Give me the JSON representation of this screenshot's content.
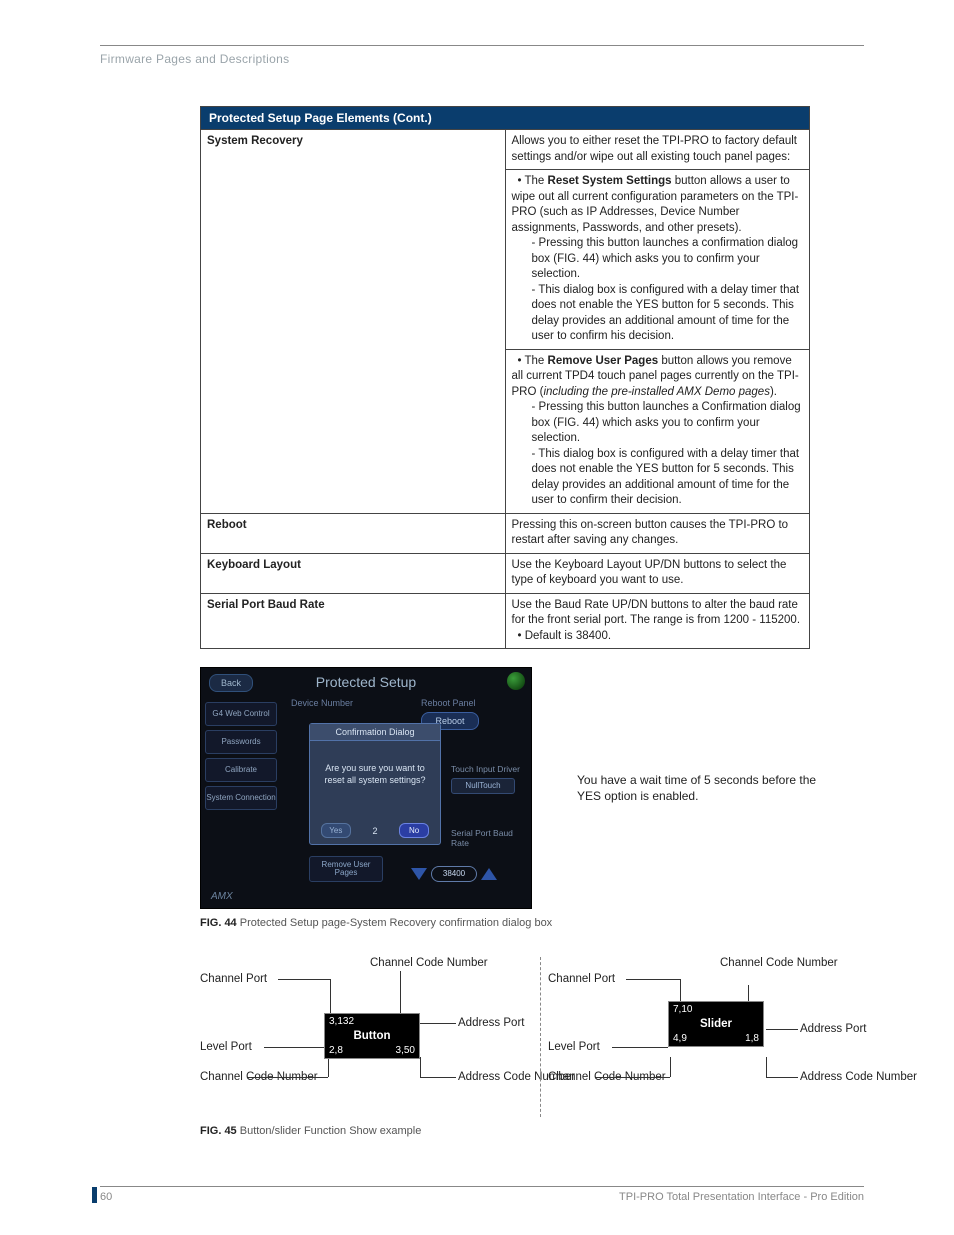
{
  "breadcrumb": "Firmware Pages and Descriptions",
  "table": {
    "title": "Protected Setup Page Elements (Cont.)",
    "rows": {
      "sysrec": {
        "label": "System Recovery",
        "intro": "Allows you to either reset the TPI-PRO to factory default settings and/or wipe out all existing touch panel pages:",
        "b1_lead": "Reset System Settings",
        "b1_tail": " button allows a user to wipe out all current configuration parameters on the TPI-PRO (such as IP Addresses, Device Number assignments, Passwords, and other presets).",
        "b1_s1": "- Pressing this button launches a confirmation dialog box (FIG. 44) which asks you to confirm your selection.",
        "b1_s2": "- This dialog box is configured with a delay timer that does not enable the YES button for 5 seconds. This delay provides an additional amount of time for the user to confirm his decision.",
        "b2_lead": "Remove User Pages",
        "b2_tail": " button allows you remove all current TPD4 touch panel pages currently on the TPI-PRO (",
        "b2_em": "including the pre-installed AMX Demo pages",
        "b2_close": ").",
        "b2_s1": "- Pressing this button launches a Confirmation dialog box (FIG. 44) which asks you to confirm your selection.",
        "b2_s2": "- This dialog box is configured with a delay timer that does not enable the YES button for 5 seconds. This delay provides an additional amount of time for the user to confirm their decision."
      },
      "reboot": {
        "label": "Reboot",
        "text": "Pressing this on-screen button causes the TPI-PRO to restart after saving any changes."
      },
      "kbd": {
        "label": "Keyboard Layout",
        "text": "Use the Keyboard Layout UP/DN buttons to select the type of keyboard you want to use."
      },
      "baud": {
        "label": "Serial Port Baud Rate",
        "l1": "Use the Baud Rate UP/DN buttons to alter the baud rate for the front serial port. The range is from 1200 - 115200.",
        "l2": "Default is 38400."
      }
    }
  },
  "fig44": {
    "title": "Protected Setup",
    "back": "Back",
    "side1": "G4 Web Control",
    "side2": "Passwords",
    "side3": "Calibrate",
    "side4": "System Connection",
    "devnum": "Device Number",
    "reboot_lbl": "Reboot Panel",
    "reboot_btn": "Reboot",
    "dlg_title": "Confirmation Dialog",
    "dlg_msg": "Are you sure you want to reset all system settings?",
    "dlg_yes": "Yes",
    "dlg_cnt": "2",
    "dlg_no": "No",
    "touch_lbl": "Touch Input Driver",
    "nulltouch": "NullTouch",
    "baud_lbl": "Serial Port Baud Rate",
    "remove": "Remove User Pages",
    "baud_val": "38400",
    "logo": "AMX",
    "note": "You have a wait time of 5 seconds before the YES option is enabled.",
    "cap_b": "FIG. 44",
    "cap": "  Protected Setup page-System Recovery confirmation dialog box"
  },
  "fig45": {
    "btn": {
      "label_cp": "Channel Port",
      "label_lp": "Level Port",
      "label_ccnL": "Channel Code Number",
      "label_ccnR": "Channel Code Number",
      "label_ap": "Address Port",
      "label_acn": "Address Code Number",
      "mid": "Button",
      "tl": "3,132",
      "bl": "2,8",
      "br": "3,50"
    },
    "sld": {
      "label_cp": "Channel Port",
      "label_lp": "Level Port",
      "label_ccnL": "Channel Code Number",
      "label_ccnR": "Channel Code Number",
      "label_ap": "Address Port",
      "label_acn": "Address Code Number",
      "mid": "Slider",
      "tl": "7,10",
      "bl": "4,9",
      "br": "1,8"
    },
    "cap_b": "FIG. 45",
    "cap": "  Button/slider Function Show example"
  },
  "footer": {
    "page": "60",
    "doc": "TPI-PRO Total Presentation Interface - Pro Edition"
  }
}
